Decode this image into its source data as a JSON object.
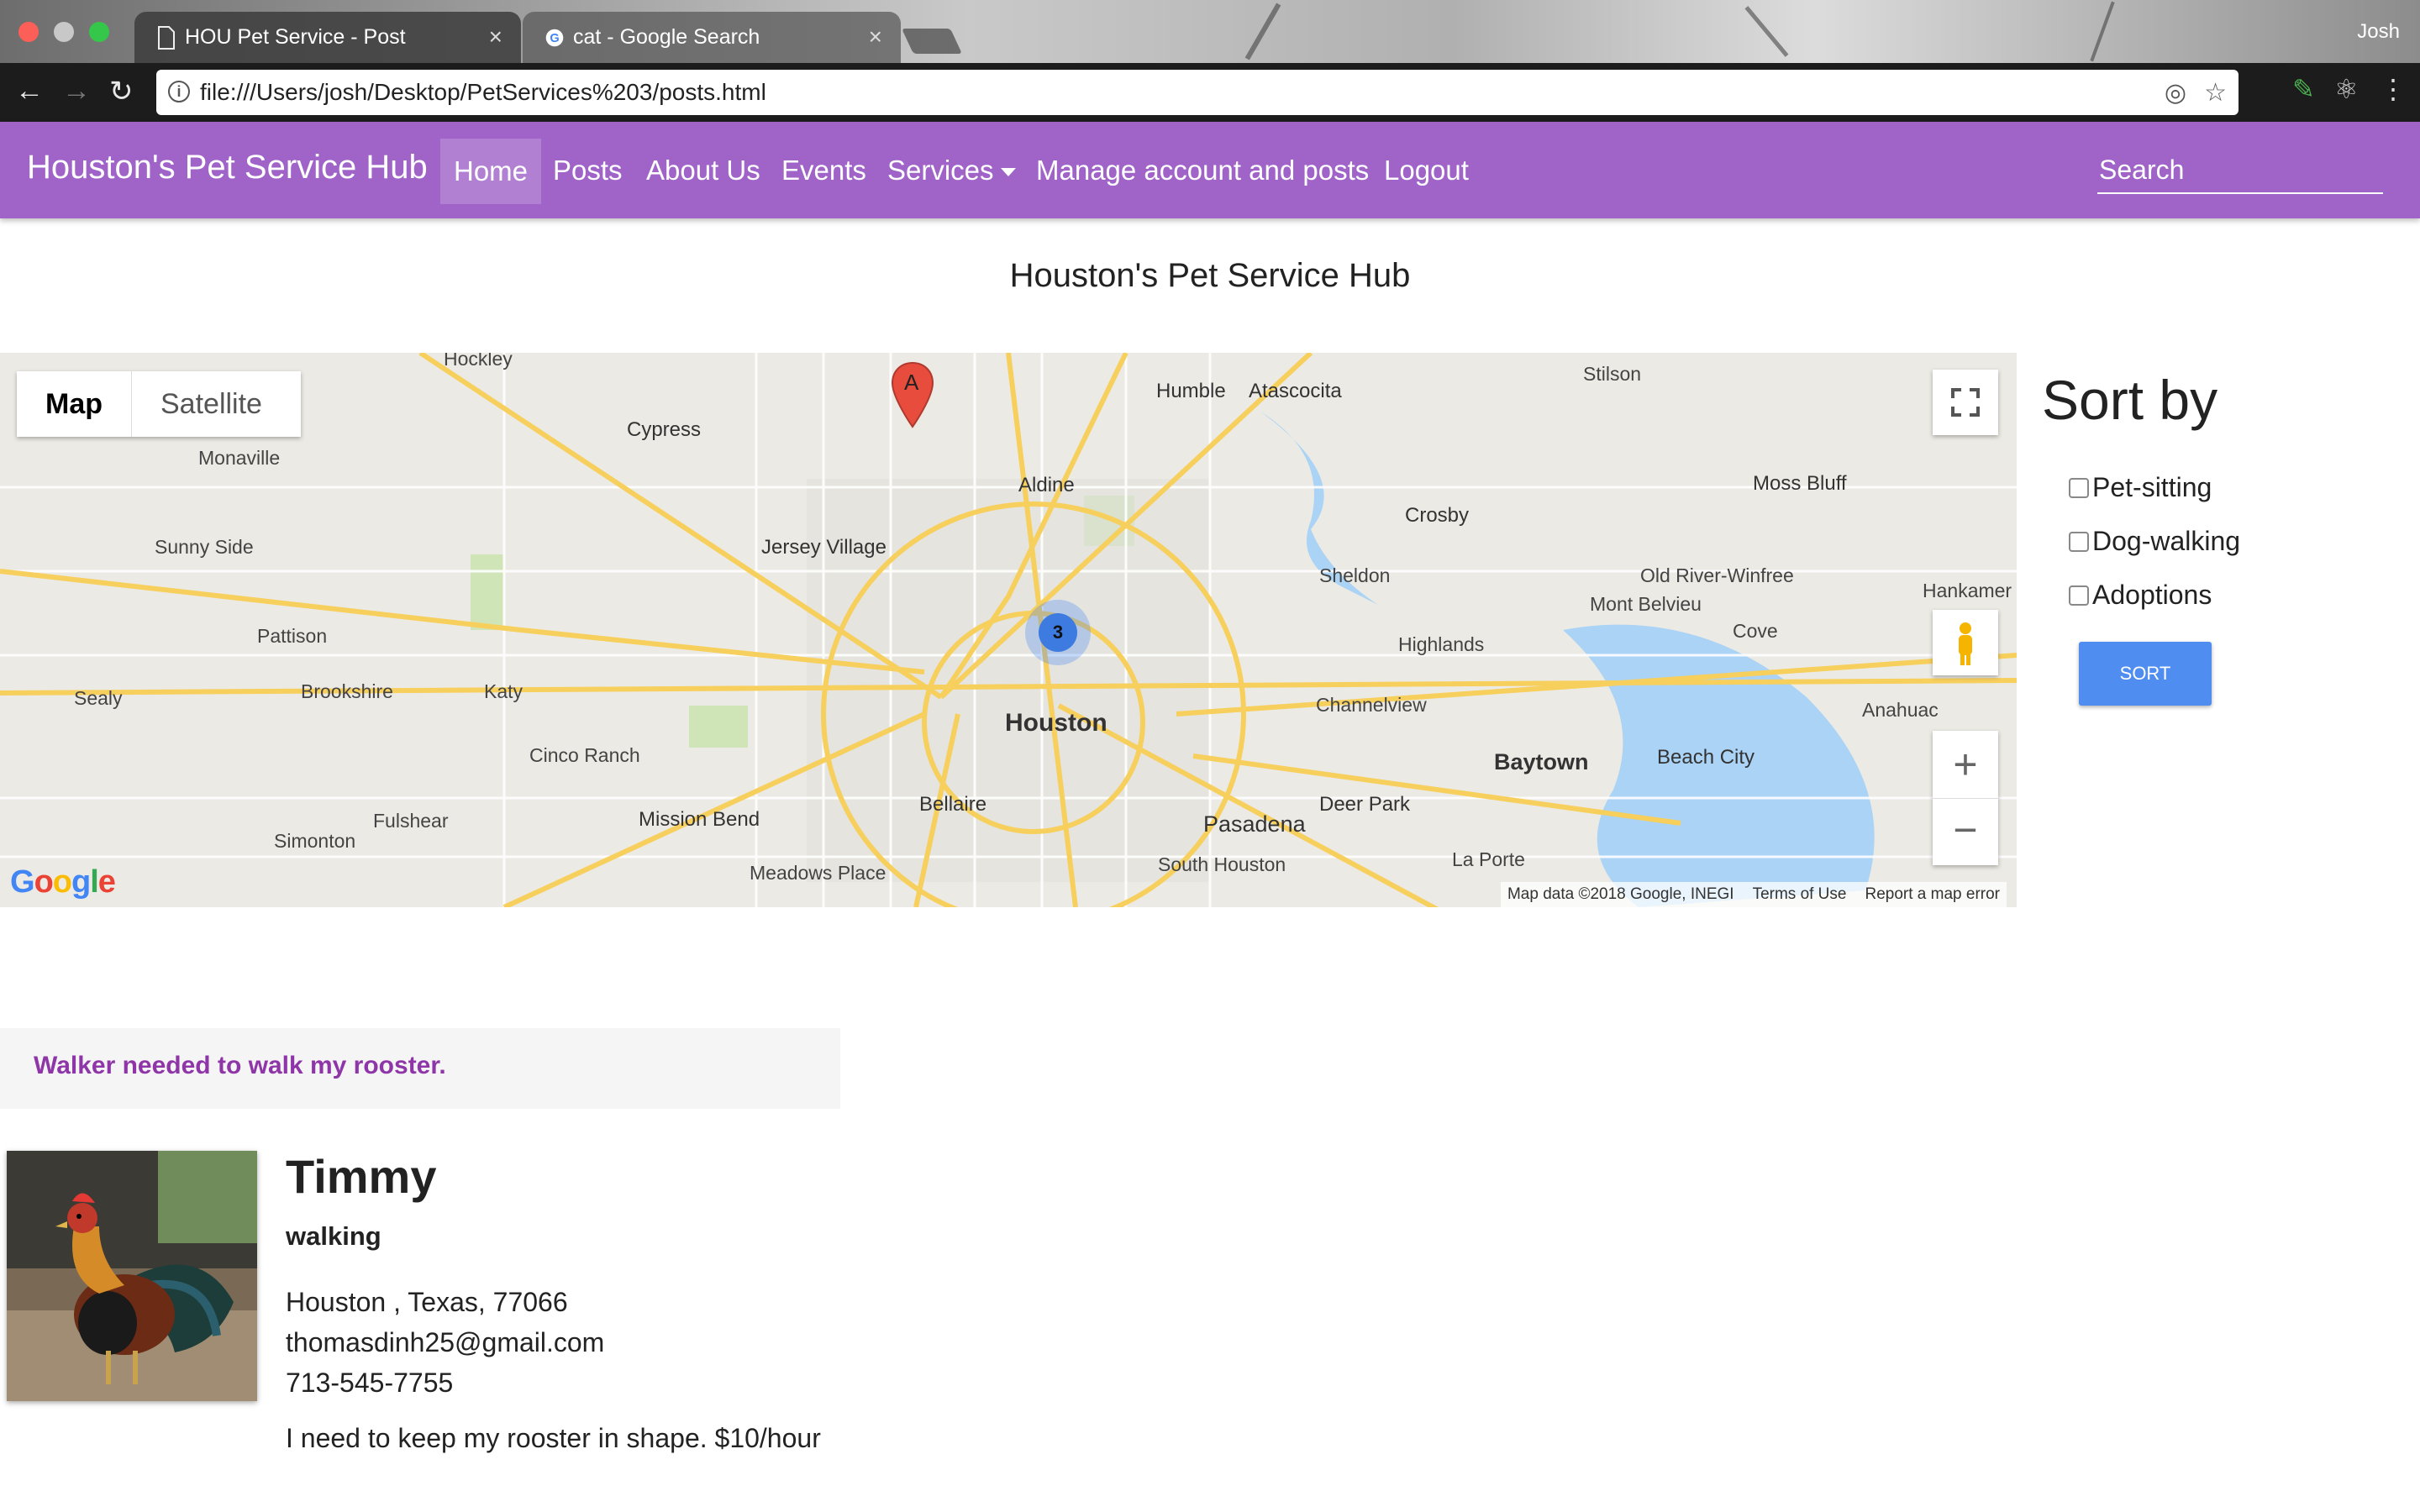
{
  "browser": {
    "tabs": [
      {
        "title": "HOU Pet Service - Post",
        "active": true
      },
      {
        "title": "cat - Google Search",
        "active": false
      }
    ],
    "profile_name": "Josh",
    "url": "file:///Users/josh/Desktop/PetServices%203/posts.html"
  },
  "navbar": {
    "brand": "Houston's Pet Service Hub",
    "links": [
      "Home",
      "Posts",
      "About Us",
      "Events",
      "Services",
      "Manage account and posts",
      "Logout"
    ],
    "search_placeholder": "Search",
    "background": "#a064c8"
  },
  "page": {
    "title": "Houston's Pet Service Hub"
  },
  "map": {
    "toggle": {
      "map_label": "Map",
      "satellite_label": "Satellite"
    },
    "marker_label": "A",
    "cluster_count": "3",
    "labels": {
      "houston": "Houston",
      "katy": "Katy",
      "cypress": "Cypress",
      "humble": "Humble",
      "atascocita": "Atascocita",
      "stilson": "Stilson",
      "aldine": "Aldine",
      "jersey_village": "Jersey Village",
      "crosby": "Crosby",
      "moss_bluff": "Moss Bluff",
      "monaville": "Monaville",
      "sunny_side": "Sunny Side",
      "pattison": "Pattison",
      "brookshire": "Brookshire",
      "sealy": "Sealy",
      "sheldon": "Sheldon",
      "old_river_winfree": "Old River-Winfree",
      "mont_belvieu": "Mont Belvieu",
      "hankamer": "Hankamer",
      "highlands": "Highlands",
      "cove": "Cove",
      "channelview": "Channelview",
      "anahuac": "Anahuac",
      "cinco_ranch": "Cinco Ranch",
      "baytown": "Baytown",
      "beach_city": "Beach City",
      "fulshear": "Fulshear",
      "mission_bend": "Mission Bend",
      "bellaire": "Bellaire",
      "pasadena": "Pasadena",
      "deer_park": "Deer Park",
      "simonton": "Simonton",
      "meadows_place": "Meadows Place",
      "south_houston": "South Houston",
      "la_porte": "La Porte"
    },
    "attribution": [
      "Map data ©2018 Google, INEGI",
      "Terms of Use",
      "Report a map error"
    ],
    "google_logo": "Google"
  },
  "sort": {
    "title": "Sort by",
    "options": [
      "Pet-sitting",
      "Dog-walking",
      "Adoptions"
    ],
    "button_label": "SORT",
    "button_color": "#4f8ef0"
  },
  "post": {
    "headline": "Walker needed to walk my rooster.",
    "name": "Timmy",
    "service": "walking",
    "location": "Houston , Texas, 77066",
    "email": "thomasdinh25@gmail.com",
    "phone": "713-545-7755",
    "description": "I need to keep my rooster in shape. $10/hour",
    "image_icon": "rooster-photo"
  }
}
